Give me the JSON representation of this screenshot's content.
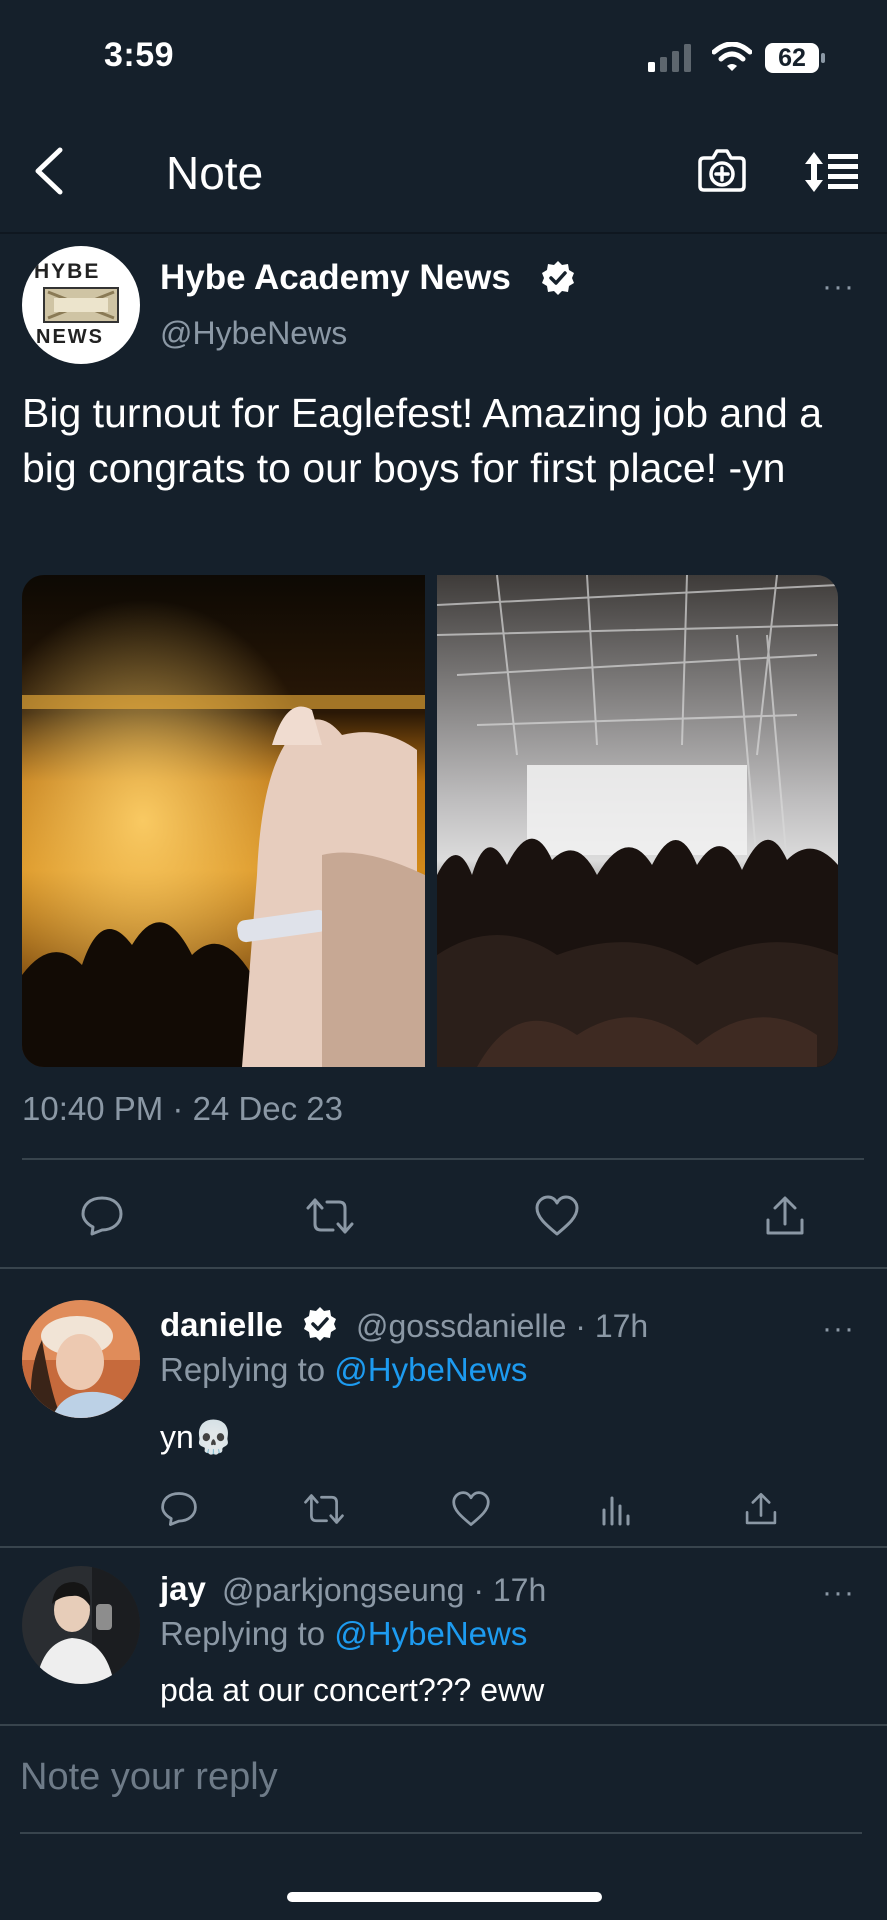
{
  "status_bar": {
    "time": "3:59",
    "battery": "62"
  },
  "nav": {
    "title": "Note"
  },
  "tweet": {
    "author_name": "Hybe Academy News",
    "handle": "@HybeNews",
    "avatar_logo_top": "HYBE",
    "avatar_logo_bottom": "NEWS",
    "text": "Big turnout for Eaglefest! Amazing job and a big congrats to our boys for first place! -yn",
    "timestamp": "10:40 PM · 24 Dec 23",
    "more": "···"
  },
  "replies": [
    {
      "name": "danielle",
      "meta": "@gossdanielle · 17h",
      "replying_prefix": "Replying to",
      "replying_handle": "@HybeNews",
      "text": "yn💀",
      "more": "···"
    },
    {
      "name": "jay",
      "meta": "@parkjongseung · 17h",
      "replying_prefix": "Replying to",
      "replying_handle": "@HybeNews",
      "text": "pda at our concert??? eww",
      "more": "···"
    }
  ],
  "reply_input": {
    "placeholder": "Note your reply"
  },
  "icons": {
    "back": "chevron-left-icon",
    "camera": "camera-plus-icon",
    "sort": "sort-icon",
    "reply": "comment-icon",
    "retweet": "retweet-icon",
    "like": "heart-icon",
    "views": "bar-chart-icon",
    "share": "share-icon"
  },
  "colors": {
    "background": "#15202b",
    "accent": "#1d9bf0",
    "muted": "#8b98a5"
  }
}
